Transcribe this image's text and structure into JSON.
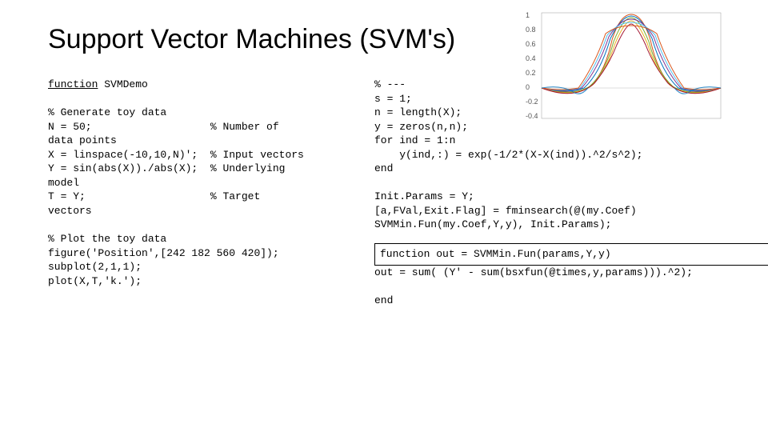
{
  "title": "Support Vector Machines (SVM's)",
  "left": {
    "l1": "function",
    "l1b": " SVMDemo",
    "l2": "% Generate toy data",
    "l3a": "N = 50;",
    "l3b": "% Number of",
    "l3c": "data points",
    "l4a": "X = linspace(-10,10,N)';",
    "l4b": "% Input vectors",
    "l5a": "Y = sin(abs(X))./abs(X);",
    "l5b": "% Underlying",
    "l5c": "model",
    "l6a": "T = Y;",
    "l6b": "% Target",
    "l6c": "vectors",
    "l7": "% Plot the toy data",
    "l8": "figure('Position',[242 182 560 420]);",
    "l9": "subplot(2,1,1);",
    "l10": "plot(X,T,'k.');"
  },
  "right": {
    "l1": "% ---",
    "l2": "s = 1;",
    "l3": "n = length(X);",
    "l4": "y = zeros(n,n);",
    "l5": "for ind = 1:n",
    "l6": "    y(ind,:) = exp(-1/2*(X-X(ind)).^2/s^2);",
    "l7": "end",
    "l8": "Init.Params = Y;",
    "l9a": "[a,FVal,Exit.Flag] = fminsearch(@(my.Coef)",
    "l9b": "SVMMin.Fun(my.Coef,Y,y), Init.Params);",
    "box1": "function out = SVMMin.Fun(params,Y,y)",
    "l10": "out = sum( (Y' - sum(bsxfun(@times,y,params))).^2);",
    "l11": "end"
  },
  "chart_data": {
    "type": "line",
    "xlim": [
      -10,
      10
    ],
    "ylim": [
      -0.4,
      1.0
    ],
    "yticks": [
      -0.4,
      -0.2,
      0,
      0.2,
      0.4,
      0.6,
      0.8,
      1
    ],
    "note": "family of gaussian/sinc-like kernel curves centered at sample points"
  }
}
